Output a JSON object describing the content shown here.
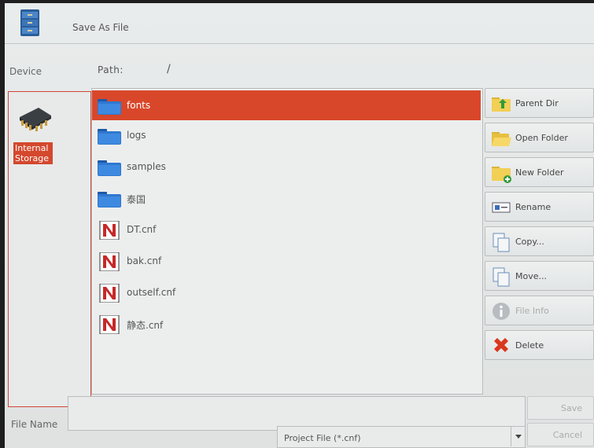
{
  "window": {
    "title": "Save As File"
  },
  "pathbar": {
    "device_label": "Device",
    "path_label": "Path:",
    "path_value": "/"
  },
  "devices": [
    {
      "label": "Internal Storage",
      "icon": "chip-icon",
      "selected": true
    }
  ],
  "files": [
    {
      "name": "fonts",
      "type": "folder",
      "selected": true
    },
    {
      "name": "logs",
      "type": "folder"
    },
    {
      "name": "samples",
      "type": "folder"
    },
    {
      "name": "泰国",
      "type": "folder"
    },
    {
      "name": "DT.cnf",
      "type": "cnf"
    },
    {
      "name": "bak.cnf",
      "type": "cnf"
    },
    {
      "name": "outself.cnf",
      "type": "cnf"
    },
    {
      "name": "静态.cnf",
      "type": "cnf"
    }
  ],
  "actions": [
    {
      "label": "Parent Dir",
      "icon": "parent-dir-icon"
    },
    {
      "label": "Open Folder",
      "icon": "open-folder-icon"
    },
    {
      "label": "New Folder",
      "icon": "new-folder-icon"
    },
    {
      "label": "Rename",
      "icon": "rename-icon"
    },
    {
      "label": "Copy...",
      "icon": "copy-icon"
    },
    {
      "label": "Move...",
      "icon": "move-icon"
    },
    {
      "label": "File Info",
      "icon": "info-icon",
      "disabled": true
    },
    {
      "label": "Delete",
      "icon": "delete-icon"
    }
  ],
  "footer": {
    "file_name_label": "File Name",
    "file_name_value": "",
    "filter_value": "Project File (*.cnf)",
    "save_label": "Save",
    "cancel_label": "Cancel"
  },
  "colors": {
    "selection": "#d9472a",
    "device_border": "#d04535"
  }
}
